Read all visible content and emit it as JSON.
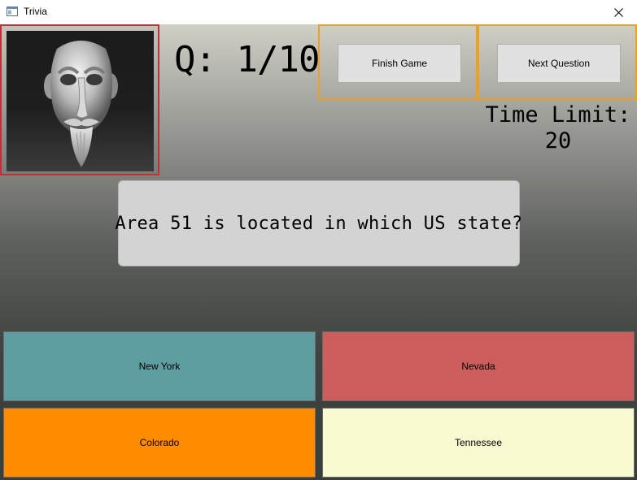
{
  "window": {
    "title": "Trivia",
    "icon": "app-window-icon",
    "close_icon": "close-icon"
  },
  "header": {
    "question_counter": "Q: 1/10",
    "finish_label": "Finish Game",
    "next_label": "Next Question",
    "time_limit_label": "Time Limit:",
    "time_limit_value": "20"
  },
  "question": {
    "text": "Area 51 is located in which US state?"
  },
  "answers": [
    {
      "label": "New York",
      "color": "#5f9ea0"
    },
    {
      "label": "Nevada",
      "color": "#cd5c5c"
    },
    {
      "label": "Colorado",
      "color": "#ff8c00"
    },
    {
      "label": "Tennessee",
      "color": "#fafad2"
    }
  ],
  "colors": {
    "avatar_border": "#c0303a",
    "button_frame_border": "#f0a020"
  }
}
